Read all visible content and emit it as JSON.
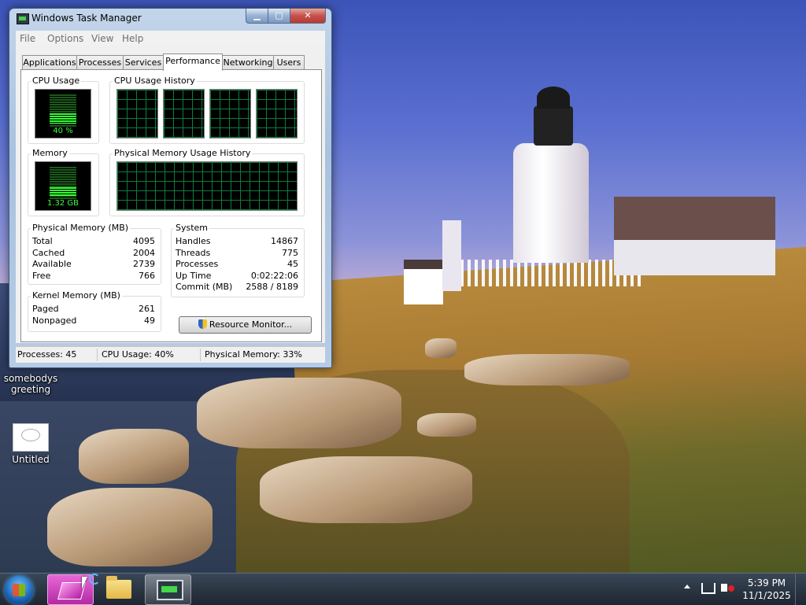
{
  "window": {
    "title": "Windows Task Manager",
    "controls": {
      "minimize": "▁",
      "maximize": "▢",
      "close": "✕"
    }
  },
  "menu": [
    "File",
    "Options",
    "View",
    "Help"
  ],
  "tabs": [
    "Applications",
    "Processes",
    "Services",
    "Performance",
    "Networking",
    "Users"
  ],
  "active_tab": "Performance",
  "performance": {
    "cpu_usage": {
      "label": "CPU Usage",
      "value": "40 %",
      "level": 0.4
    },
    "cpu_history_label": "CPU Usage History",
    "memory": {
      "label": "Memory",
      "value": "1.32 GB",
      "level": 0.33
    },
    "memory_history_label": "Physical Memory Usage History",
    "physical_memory": {
      "label": "Physical Memory (MB)",
      "rows": [
        {
          "k": "Total",
          "v": "4095"
        },
        {
          "k": "Cached",
          "v": "2004"
        },
        {
          "k": "Available",
          "v": "2739"
        },
        {
          "k": "Free",
          "v": "766"
        }
      ]
    },
    "system": {
      "label": "System",
      "rows": [
        {
          "k": "Handles",
          "v": "14867"
        },
        {
          "k": "Threads",
          "v": "775"
        },
        {
          "k": "Processes",
          "v": "45"
        },
        {
          "k": "Up Time",
          "v": "0:02:22:06"
        },
        {
          "k": "Commit (MB)",
          "v": "2588 / 8189"
        }
      ]
    },
    "kernel_memory": {
      "label": "Kernel Memory (MB)",
      "rows": [
        {
          "k": "Paged",
          "v": "261"
        },
        {
          "k": "Nonpaged",
          "v": "49"
        }
      ]
    },
    "resource_monitor_button": "Resource Monitor..."
  },
  "status_bar": {
    "processes": "Processes: 45",
    "cpu": "CPU Usage: 40%",
    "memory": "Physical Memory: 33%"
  },
  "desktop_icons": [
    {
      "label": "somebodys greeting"
    },
    {
      "label": "Untitled"
    }
  ],
  "taskbar": {
    "clock_time": "5:39 PM",
    "clock_date": "11/1/2025"
  }
}
